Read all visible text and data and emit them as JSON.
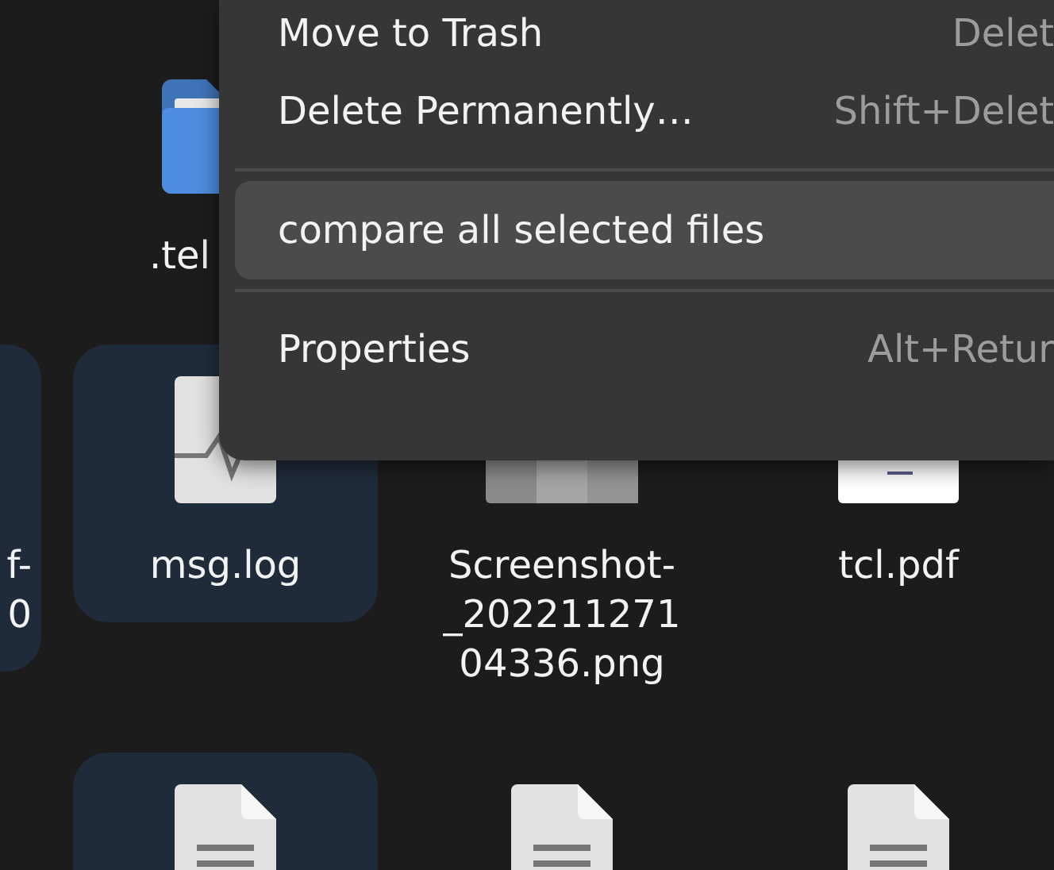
{
  "files": {
    "rows": [
      [
        {
          "kind": "blank",
          "selected": false
        },
        {
          "kind": "folder",
          "label": ".tel",
          "selected": false
        }
      ],
      [
        {
          "kind": "partial",
          "label": "f-\n0",
          "selected": true
        },
        {
          "kind": "log",
          "label": "msg.log",
          "selected": true
        },
        {
          "kind": "image",
          "label": "Screenshot-\n_202211271\n04336.png",
          "selected": false
        },
        {
          "kind": "pdf",
          "label": "tcl.pdf",
          "selected": false
        }
      ],
      [
        {
          "kind": "blank",
          "selected": false
        },
        {
          "kind": "text",
          "selected": true
        },
        {
          "kind": "text",
          "selected": false
        },
        {
          "kind": "text",
          "selected": false
        }
      ]
    ]
  },
  "context_menu": {
    "items": [
      {
        "kind": "item",
        "label": "Move to Trash",
        "shortcut": "Delet",
        "highlighted": false
      },
      {
        "kind": "item",
        "label": "Delete Permanently…",
        "shortcut": "Shift+Delet",
        "highlighted": false
      },
      {
        "kind": "separator"
      },
      {
        "kind": "item",
        "label": "compare all selected files",
        "highlighted": true
      },
      {
        "kind": "separator"
      },
      {
        "kind": "item",
        "label": "Properties",
        "shortcut": "Alt+Retur",
        "highlighted": false
      }
    ]
  }
}
